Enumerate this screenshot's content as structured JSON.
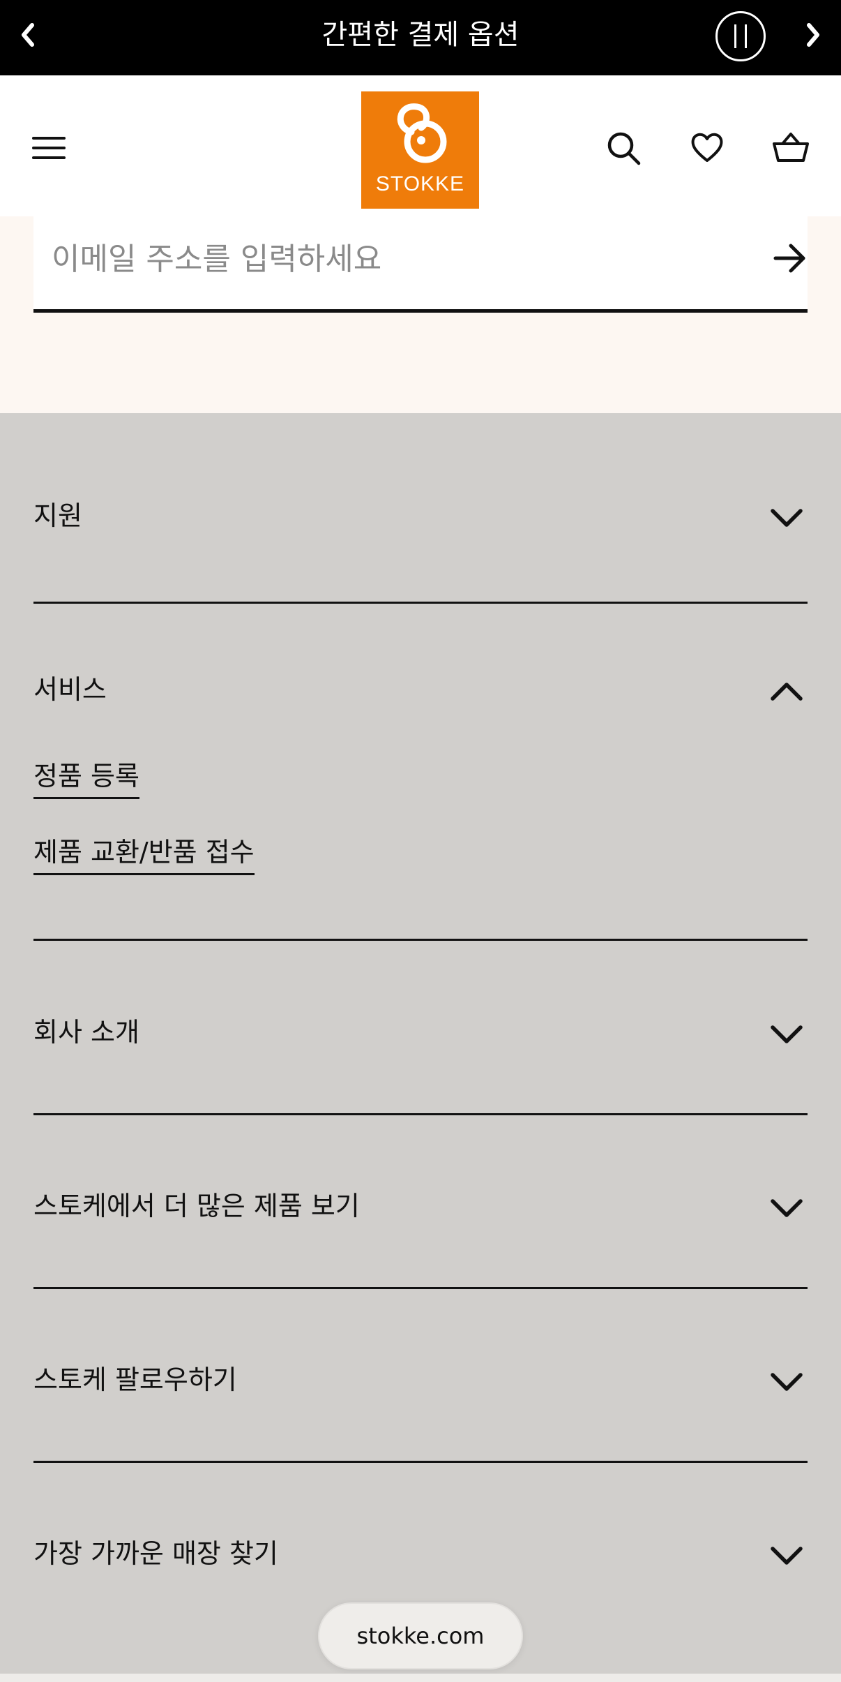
{
  "announcement": {
    "text": "간편한 결제 옵션"
  },
  "header": {
    "logo_text": "STOKKE"
  },
  "newsletter": {
    "email_placeholder": "이메일 주소를 입력하세요"
  },
  "footer": {
    "sections": [
      {
        "title": "지원",
        "expanded": false
      },
      {
        "title": "서비스",
        "expanded": true,
        "links": [
          "정품 등록",
          "제품 교환/반품 접수"
        ]
      },
      {
        "title": "회사 소개",
        "expanded": false
      },
      {
        "title": "스토케에서 더 많은 제품 보기",
        "expanded": false
      },
      {
        "title": "스토케 팔로우하기",
        "expanded": false
      },
      {
        "title": "가장 가까운 매장 찾기",
        "expanded": false
      }
    ]
  },
  "browser": {
    "domain": "stokke.com"
  },
  "colors": {
    "brand_orange": "#ef7c0a",
    "footer_bg": "#d1cfcc",
    "newsletter_bg": "#fdf7f2"
  },
  "icons": [
    "chevron-left-icon",
    "pause-icon",
    "chevron-right-icon",
    "hamburger-menu-icon",
    "search-icon",
    "heart-icon",
    "basket-icon",
    "arrow-right-icon",
    "chevron-down-icon",
    "chevron-up-icon"
  ]
}
